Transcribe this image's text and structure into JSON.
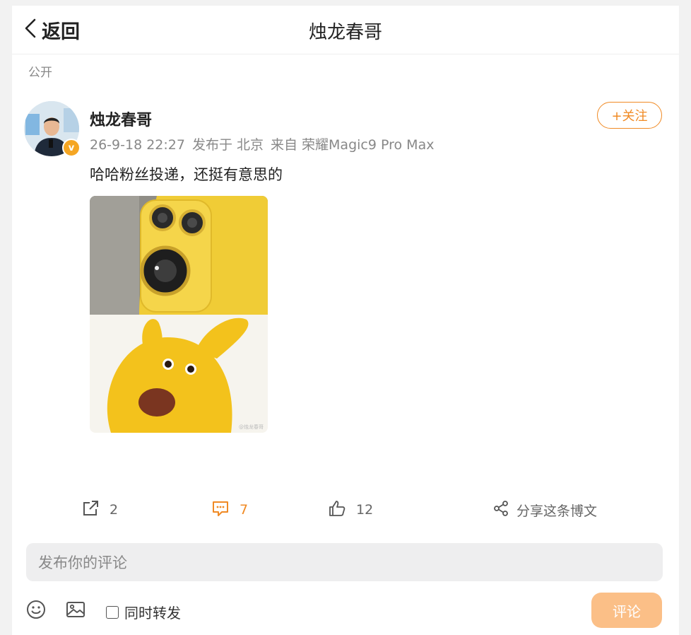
{
  "header": {
    "back_label": "返回",
    "title": "烛龙春哥"
  },
  "post": {
    "visibility": "公开",
    "author": "烛龙春哥",
    "verified_badge": "v",
    "time": "26-9-18 22:27",
    "location": "发布于 北京",
    "device": "来自 荣耀Magic9 Pro Max",
    "follow_label": "+关注",
    "text": "哈哈粉丝投递，还挺有意思的",
    "image_watermark": "@烛龙春哥",
    "colors": {
      "accent": "#f08a24",
      "phone_yellow": "#f2cf3a",
      "mascot_yellow": "#f6c51d"
    }
  },
  "actions": {
    "repost_count": "2",
    "comment_count": "7",
    "like_count": "12",
    "share_label": "分享这条博文",
    "icons": [
      "repost-icon",
      "comment-icon",
      "like-icon",
      "share-icon"
    ]
  },
  "composer": {
    "placeholder": "发布你的评论",
    "repost_label": "同时转发",
    "repost_checked": false,
    "send_label": "评论",
    "icons": [
      "emoji-icon",
      "image-icon"
    ]
  }
}
